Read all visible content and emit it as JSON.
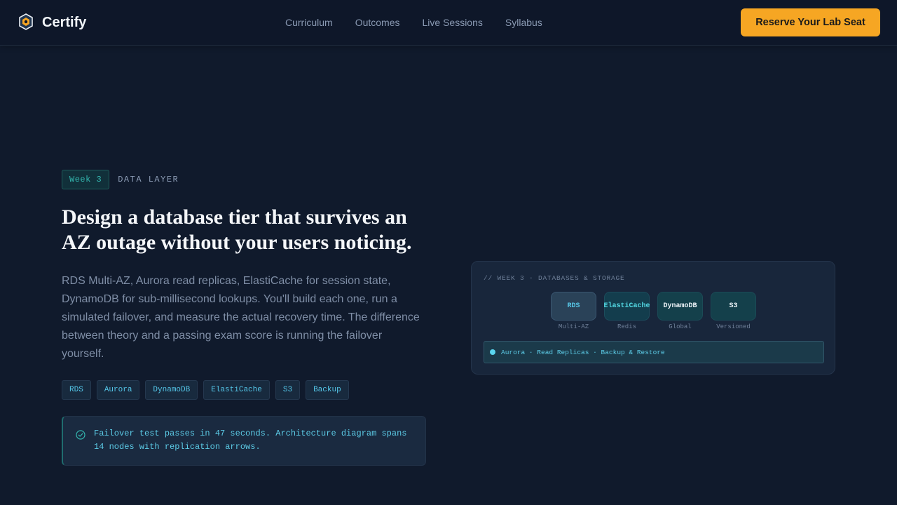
{
  "header": {
    "brand": "Certify",
    "nav": [
      "Curriculum",
      "Outcomes",
      "Live Sessions",
      "Syllabus"
    ],
    "cta": "Reserve Your Lab Seat"
  },
  "hero": {
    "week_badge": "Week 3",
    "eyebrow_label": "DATA LAYER",
    "headline": "Design a database tier that survives an AZ outage without your users noticing.",
    "body": "RDS Multi-AZ, Aurora read replicas, ElastiCache for session state, DynamoDB for sub-millisecond lookups. You'll build each one, run a simulated failover, and measure the actual recovery time. The difference between theory and a passing exam score is running the failover yourself.",
    "tags": [
      "RDS",
      "Aurora",
      "DynamoDB",
      "ElastiCache",
      "S3",
      "Backup"
    ],
    "callout": "Failover test passes in 47 seconds. Architecture diagram spans 14 nodes with replication arrows."
  },
  "diagram": {
    "title": "// WEEK 3 · DATABASES & STORAGE",
    "nodes": [
      {
        "label": "RDS",
        "sub": "Multi-AZ"
      },
      {
        "label": "ElastiCache",
        "sub": "Redis"
      },
      {
        "label": "DynamoDB",
        "sub": "Global"
      },
      {
        "label": "S3",
        "sub": "Versioned"
      }
    ],
    "bar": "Aurora · Read Replicas · Backup & Restore"
  },
  "colors": {
    "background": "#101a2c",
    "accent": "#f6a623",
    "teal": "#34b8b0",
    "cyan": "#5ccbe6"
  }
}
